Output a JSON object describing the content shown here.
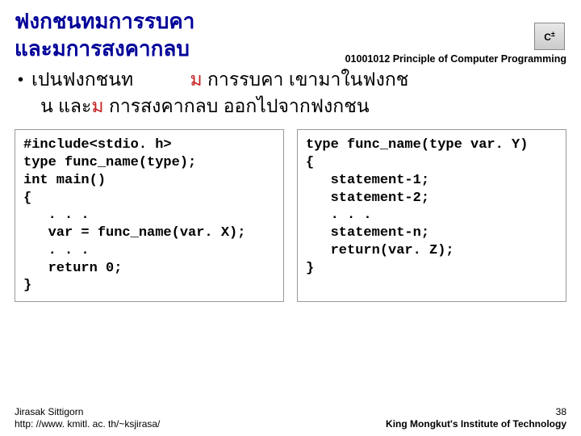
{
  "header": {
    "course_code": "01001012 Principle of Computer Programming",
    "icon_label": "C"
  },
  "title": {
    "line1": "ฟงกชนทมการรบคา",
    "line2": "และมการสงคากลบ"
  },
  "bullet": {
    "part1": "เปนฟงกชนท",
    "m1": "ม",
    "part2": " การรบคา    เขามาในฟงกช",
    "part3": "น   และ",
    "m2": "ม",
    "part4": "  การสงคากลบ     ออกไปจากฟงกชน"
  },
  "code_left": "#include<stdio. h>\ntype func_name(type);\nint main()\n{\n   . . .\n   var = func_name(var. X);\n   . . .\n   return 0;\n}",
  "code_right": "type func_name(type var. Y)\n{\n   statement-1;\n   statement-2;\n   . . .\n   statement-n;\n   return(var. Z);\n}",
  "footer": {
    "author": "Jirasak Sittigorn",
    "url": "http: //www. kmitl. ac. th/~ksjirasa/",
    "page": "38",
    "institute": "King Mongkut's Institute of Technology"
  }
}
